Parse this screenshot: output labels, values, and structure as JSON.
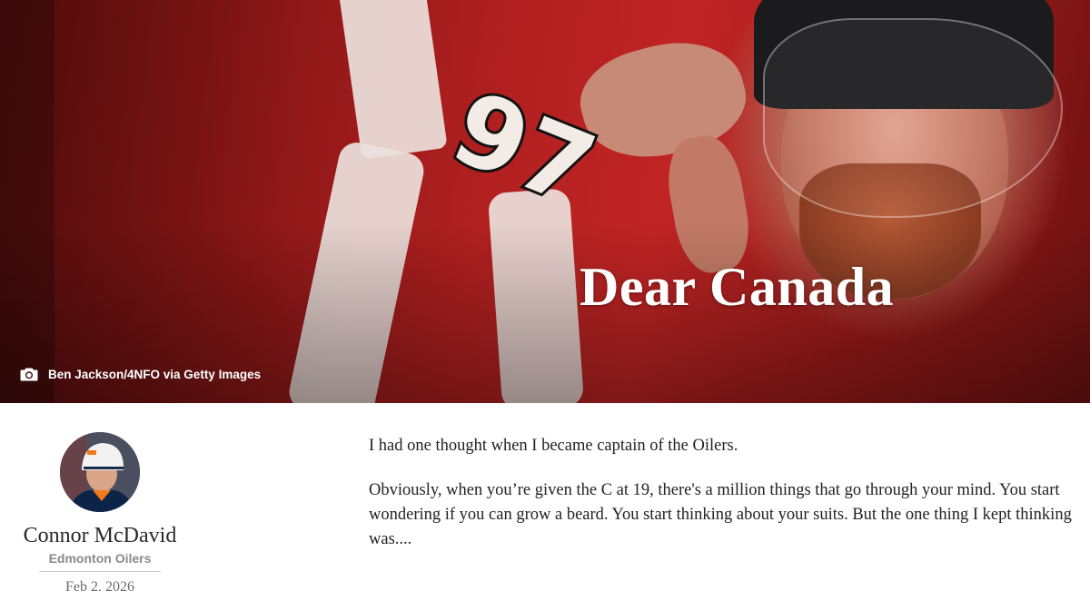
{
  "hero": {
    "title": "Dear Canada",
    "jersey_number": "97",
    "photo_credit": "Ben Jackson/4NFO via Getty Images",
    "photo_credit_icon": "camera-icon"
  },
  "author": {
    "name": "Connor McDavid",
    "team": "Edmonton Oilers",
    "date": "Feb 2, 2026",
    "avatar_icon": "avatar-photo"
  },
  "article": {
    "paragraphs": [
      "I had one thought when I became captain of the Oilers.",
      "Obviously, when you’re given the C at 19, there's a million things that go through your mind. You start wondering if you can grow a beard. You start thinking about your suits. But the one thing I kept thinking was...."
    ]
  },
  "colors": {
    "hero_red": "#b22020",
    "text": "#222222",
    "muted": "#8a8a8a"
  }
}
